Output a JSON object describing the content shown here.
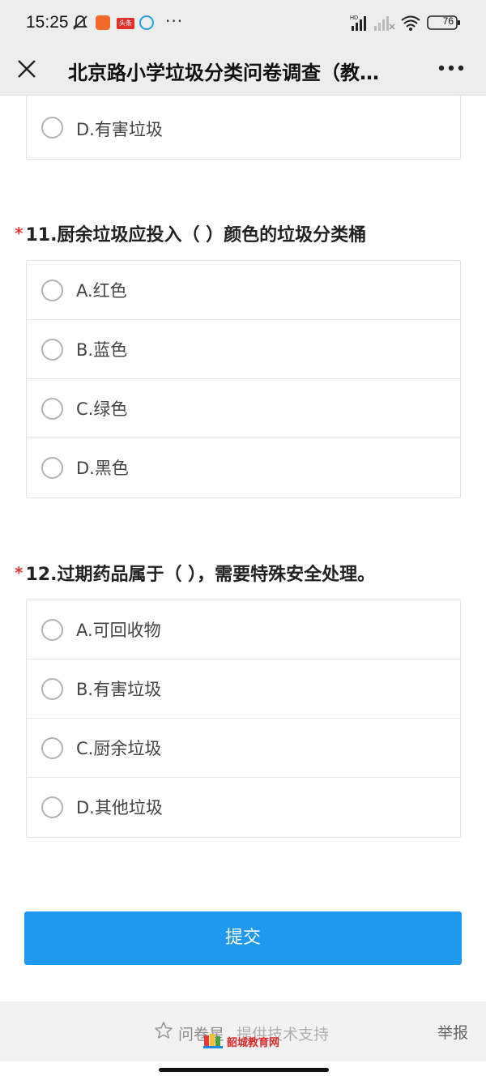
{
  "status_bar": {
    "time": "15:25",
    "badge_text": "头条",
    "battery": "76",
    "dots": "···"
  },
  "nav": {
    "title": "北京路小学垃圾分类问卷调查（教…"
  },
  "prev_question": {
    "options": [
      {
        "label": "D.有害垃圾"
      }
    ]
  },
  "questions": [
    {
      "required_mark": "*",
      "title": "11.厨余垃圾应投入（   ）颜色的垃圾分类桶",
      "options": [
        {
          "label": "A.红色"
        },
        {
          "label": "B.蓝色"
        },
        {
          "label": "C.绿色"
        },
        {
          "label": "D.黑色"
        }
      ]
    },
    {
      "required_mark": "*",
      "title": "12.过期药品属于（   ），需要特殊安全处理。",
      "options": [
        {
          "label": "A.可回收物"
        },
        {
          "label": "B.有害垃圾"
        },
        {
          "label": "C.厨余垃圾"
        },
        {
          "label": "D.其他垃圾"
        }
      ]
    }
  ],
  "submit_label": "提交",
  "footer": {
    "brand": "问卷星",
    "support": "提供技术支持",
    "report": "举报",
    "watermark": "韶城教育网"
  },
  "colors": {
    "accent": "#1f98f0",
    "required": "#e53935",
    "watermark": "#d92b2b"
  }
}
